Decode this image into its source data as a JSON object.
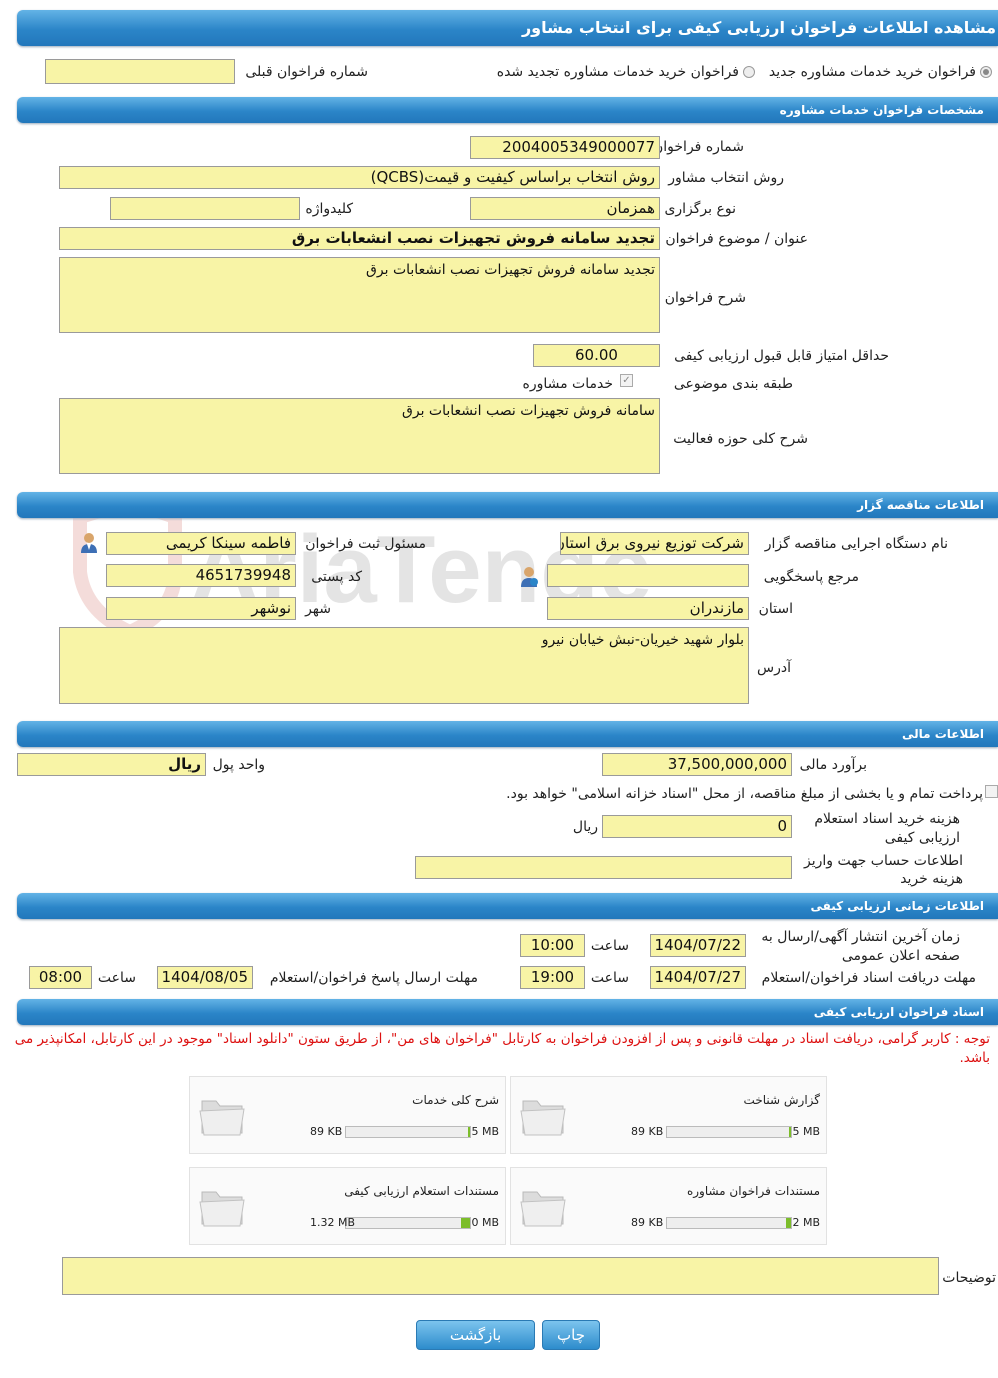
{
  "header": {
    "title": "مشاهده اطلاعات فراخوان ارزیابی کیفی برای انتخاب مشاور"
  },
  "type_select": {
    "option_new": "فراخوان خرید خدمات مشاوره جدید",
    "option_renewed": "فراخوان خرید خدمات مشاوره تجدید شده",
    "prev_number_label": "شماره فراخوان قبلی",
    "prev_number_value": ""
  },
  "sections": {
    "spec": "مشخصات فراخوان خدمات مشاوره",
    "tender": "اطلاعات مناقصه گزار",
    "financial": "اطلاعات مالی",
    "timing": "اطلاعات زمانی ارزیابی کیفی",
    "docs": "اسناد فراخوان ارزیابی کیفی"
  },
  "spec": {
    "number_label": "شماره فراخوان",
    "number_value": "2004005349000077",
    "method_label": "روش انتخاب مشاور",
    "method_value": "روش انتخاب براساس کیفیت و قیمت(QCBS)",
    "holding_label": "نوع برگزاری",
    "holding_value": "همزمان",
    "keyword_label": "کلیدواژه",
    "keyword_value": "",
    "subject_label": "عنوان / موضوع فراخوان",
    "subject_value": "تجدید سامانه فروش تجهیزات نصب انشعابات برق",
    "desc_label": "شرح فراخوان",
    "desc_value": "تجدید سامانه فروش تجهیزات نصب انشعابات برق",
    "min_score_label": "حداقل امتیاز قابل قبول ارزیابی کیفی",
    "min_score_value": "60.00",
    "category_label": "طبقه بندی موضوعی",
    "category_value": "خدمات مشاوره",
    "scope_label": "شرح کلی حوزه فعالیت",
    "scope_value": "سامانه فروش تجهیزات نصب انشعابات برق"
  },
  "tender": {
    "org_label": "نام دستگاه اجرایی مناقصه گزار",
    "org_value": "شرکت توزیع نیروی برق استان مازندران",
    "responsible_label": "مسئول ثبت فراخوان",
    "responsible_value": "فاطمه  سینکا کریمی",
    "reference_label": "مرجع پاسخگویی",
    "reference_value": "",
    "postal_label": "کد پستی",
    "postal_value": "4651739948",
    "province_label": "استان",
    "province_value": "مازندران",
    "city_label": "شهر",
    "city_value": "نوشهر",
    "address_label": "آدرس",
    "address_value": "بلوار شهید خیریان-نبش خیابان نیرو"
  },
  "financial": {
    "estimate_label": "برآورد مالی",
    "estimate_value": "37,500,000,000",
    "currency_label": "واحد پول",
    "currency_value": "ریال",
    "treasury_text": "پرداخت تمام و یا بخشی از مبلغ مناقصه، از محل \"اسناد خزانه اسلامی\" خواهد بود.",
    "doc_fee_label": "هزینه خرید اسناد استعلام ارزیابی کیفی",
    "doc_fee_value": "0",
    "doc_fee_unit": "ریال",
    "account_label": "اطلاعات حساب جهت واریز هزینه خرید",
    "account_value": ""
  },
  "timing": {
    "publish_label": "زمان آخرین انتشار آگهی/ارسال به صفحه اعلان عمومی",
    "publish_date": "1404/07/22",
    "time_label": "ساعت",
    "publish_time": "10:00",
    "receive_label": "مهلت دریافت اسناد فراخوان/استعلام",
    "receive_date": "1404/07/27",
    "receive_time": "19:00",
    "submit_label": "مهلت ارسال پاسخ فراخوان/استعلام",
    "submit_date": "1404/08/05",
    "submit_time": "08:00"
  },
  "docs": {
    "note": "توجه : کاربر گرامی، دریافت اسناد در مهلت قانونی و پس از افزودن فراخوان به کارتابل \"فراخوان های من\"، از طریق ستون \"دانلود اسناد\" موجود در این کارتابل، امکانپذیر می باشد.",
    "files": [
      {
        "name": "گزارش شناخت",
        "max": "5 MB",
        "size": "89 KB",
        "fill": 0.02
      },
      {
        "name": "شرح کلی خدمات",
        "max": "5 MB",
        "size": "89 KB",
        "fill": 0.02
      },
      {
        "name": "مستندات فراخوان مشاوره",
        "max": "2 MB",
        "size": "89 KB",
        "fill": 0.04
      },
      {
        "name": "مستندات استعلام ارزیابی کیفی",
        "max": "20 MB",
        "size": "1.32 MB",
        "fill": 0.07
      }
    ],
    "comments_label": "توضیحات",
    "comments_value": ""
  },
  "buttons": {
    "print": "چاپ",
    "back": "بازگشت"
  },
  "watermark": "AriaTender.neT",
  "colors": {
    "accent": "#2b85c8",
    "field": "#f8f4a6",
    "note": "#dd1111",
    "progress": "#7cbd2a"
  }
}
